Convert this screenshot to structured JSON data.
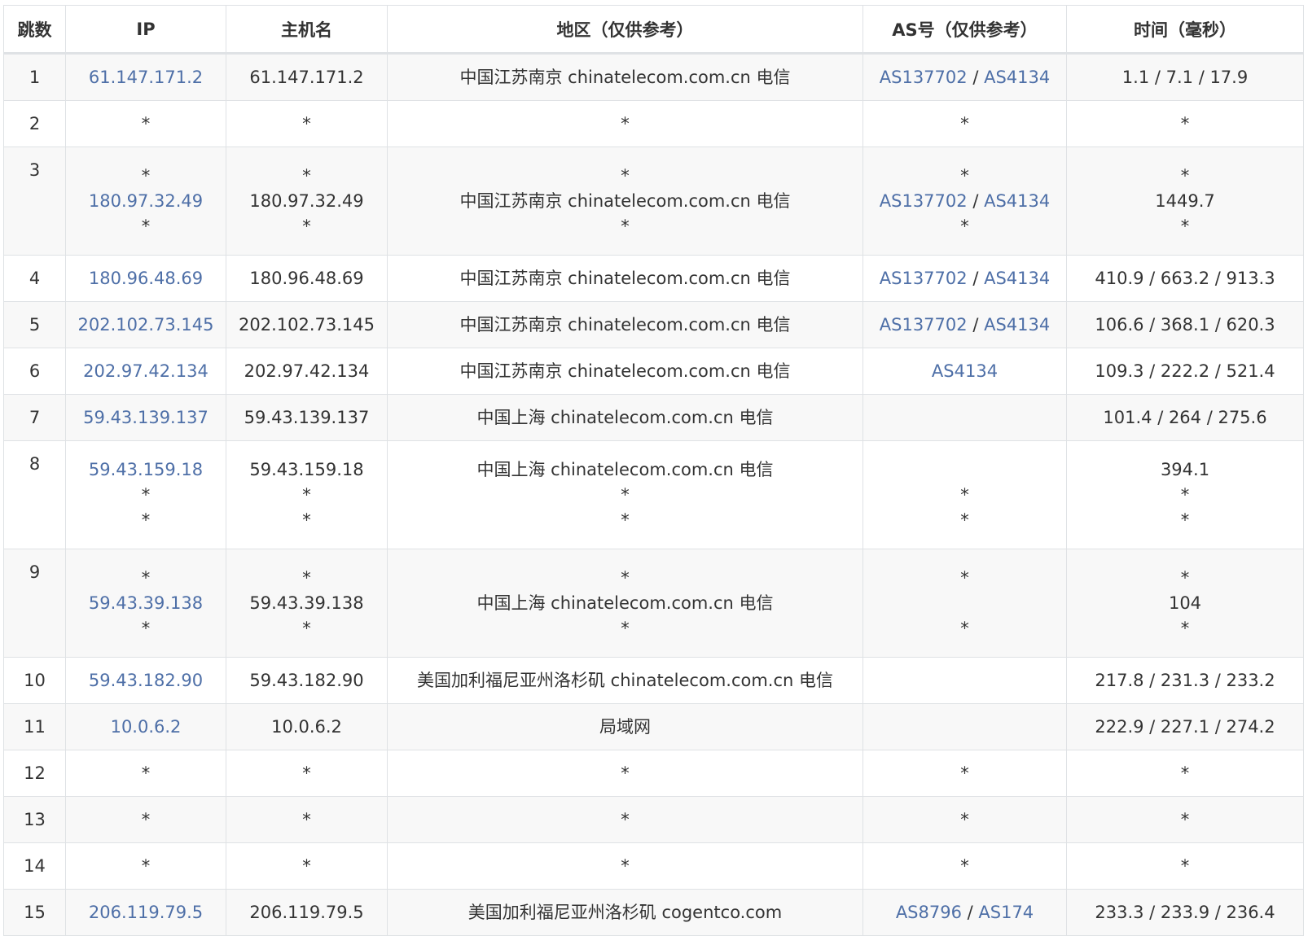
{
  "headers": [
    "跳数",
    "IP",
    "主机名",
    "地区（仅供参考）",
    "AS号（仅供参考）",
    "时间（毫秒）"
  ],
  "colors": {
    "link": "#4e6fa7",
    "text": "#333333",
    "stripe": "#f8f8f8",
    "border": "#dfe2e5"
  },
  "rows": [
    {
      "hop": "1",
      "ip": [
        "61.147.171.2"
      ],
      "host": [
        "61.147.171.2"
      ],
      "region": [
        "中国江苏南京 chinatelecom.com.cn 电信"
      ],
      "as": [
        [
          "AS137702",
          "AS4134"
        ]
      ],
      "time": [
        "1.1 / 7.1 / 17.9"
      ]
    },
    {
      "hop": "2",
      "ip": [
        "*"
      ],
      "host": [
        "*"
      ],
      "region": [
        "*"
      ],
      "as": [
        "*"
      ],
      "time": [
        "*"
      ]
    },
    {
      "hop": "3",
      "ip": [
        "*",
        "180.97.32.49",
        "*"
      ],
      "host": [
        "*",
        "180.97.32.49",
        "*"
      ],
      "region": [
        "*",
        "中国江苏南京 chinatelecom.com.cn 电信",
        "*"
      ],
      "as": [
        "*",
        [
          "AS137702",
          "AS4134"
        ],
        "*"
      ],
      "time": [
        "*",
        "1449.7",
        "*"
      ]
    },
    {
      "hop": "4",
      "ip": [
        "180.96.48.69"
      ],
      "host": [
        "180.96.48.69"
      ],
      "region": [
        "中国江苏南京 chinatelecom.com.cn 电信"
      ],
      "as": [
        [
          "AS137702",
          "AS4134"
        ]
      ],
      "time": [
        "410.9 / 663.2 / 913.3"
      ]
    },
    {
      "hop": "5",
      "ip": [
        "202.102.73.145"
      ],
      "host": [
        "202.102.73.145"
      ],
      "region": [
        "中国江苏南京 chinatelecom.com.cn 电信"
      ],
      "as": [
        [
          "AS137702",
          "AS4134"
        ]
      ],
      "time": [
        "106.6 / 368.1 / 620.3"
      ]
    },
    {
      "hop": "6",
      "ip": [
        "202.97.42.134"
      ],
      "host": [
        "202.97.42.134"
      ],
      "region": [
        "中国江苏南京 chinatelecom.com.cn 电信"
      ],
      "as": [
        [
          "AS4134"
        ]
      ],
      "time": [
        "109.3 / 222.2 / 521.4"
      ]
    },
    {
      "hop": "7",
      "ip": [
        "59.43.139.137"
      ],
      "host": [
        "59.43.139.137"
      ],
      "region": [
        "中国上海 chinatelecom.com.cn 电信"
      ],
      "as": [
        ""
      ],
      "time": [
        "101.4 / 264 / 275.6"
      ]
    },
    {
      "hop": "8",
      "ip": [
        "59.43.159.18",
        "*",
        "*"
      ],
      "host": [
        "59.43.159.18",
        "*",
        "*"
      ],
      "region": [
        "中国上海 chinatelecom.com.cn 电信",
        "*",
        "*"
      ],
      "as": [
        "",
        "*",
        "*"
      ],
      "time": [
        "394.1",
        "*",
        "*"
      ]
    },
    {
      "hop": "9",
      "ip": [
        "*",
        "59.43.39.138",
        "*"
      ],
      "host": [
        "*",
        "59.43.39.138",
        "*"
      ],
      "region": [
        "*",
        "中国上海 chinatelecom.com.cn 电信",
        "*"
      ],
      "as": [
        "*",
        "",
        "*"
      ],
      "time": [
        "*",
        "104",
        "*"
      ]
    },
    {
      "hop": "10",
      "ip": [
        "59.43.182.90"
      ],
      "host": [
        "59.43.182.90"
      ],
      "region": [
        "美国加利福尼亚州洛杉矶 chinatelecom.com.cn 电信"
      ],
      "as": [
        ""
      ],
      "time": [
        "217.8 / 231.3 / 233.2"
      ]
    },
    {
      "hop": "11",
      "ip": [
        "10.0.6.2"
      ],
      "host": [
        "10.0.6.2"
      ],
      "region": [
        "局域网"
      ],
      "as": [
        ""
      ],
      "time": [
        "222.9 / 227.1 / 274.2"
      ]
    },
    {
      "hop": "12",
      "ip": [
        "*"
      ],
      "host": [
        "*"
      ],
      "region": [
        "*"
      ],
      "as": [
        "*"
      ],
      "time": [
        "*"
      ]
    },
    {
      "hop": "13",
      "ip": [
        "*"
      ],
      "host": [
        "*"
      ],
      "region": [
        "*"
      ],
      "as": [
        "*"
      ],
      "time": [
        "*"
      ]
    },
    {
      "hop": "14",
      "ip": [
        "*"
      ],
      "host": [
        "*"
      ],
      "region": [
        "*"
      ],
      "as": [
        "*"
      ],
      "time": [
        "*"
      ]
    },
    {
      "hop": "15",
      "ip": [
        "206.119.79.5"
      ],
      "host": [
        "206.119.79.5"
      ],
      "region": [
        "美国加利福尼亚州洛杉矶 cogentco.com"
      ],
      "as": [
        [
          "AS8796",
          "AS174"
        ]
      ],
      "time": [
        "233.3 / 233.9 / 236.4"
      ]
    }
  ]
}
